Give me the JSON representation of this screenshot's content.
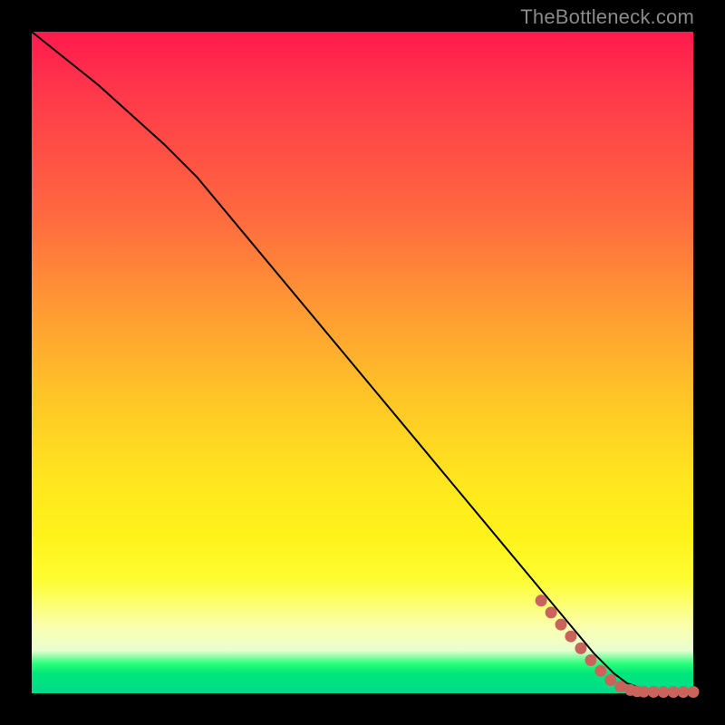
{
  "watermark": "TheBottleneck.com",
  "chart_data": {
    "type": "line",
    "title": "",
    "xlabel": "",
    "ylabel": "",
    "xlim": [
      0,
      100
    ],
    "ylim": [
      0,
      100
    ],
    "series": [
      {
        "name": "curve",
        "x": [
          0,
          10,
          20,
          25,
          30,
          40,
          50,
          60,
          70,
          80,
          85,
          88,
          90,
          92,
          95,
          98,
          100
        ],
        "y": [
          100,
          92,
          83,
          78,
          72,
          60,
          48,
          36,
          24,
          12,
          6,
          3,
          1.5,
          0.8,
          0.4,
          0.2,
          0.15
        ],
        "style": "solid",
        "color": "#000000"
      }
    ],
    "markers": {
      "color": "#c9635b",
      "points": [
        {
          "x": 77,
          "y": 14
        },
        {
          "x": 78.5,
          "y": 12.2
        },
        {
          "x": 80,
          "y": 10.4
        },
        {
          "x": 81.5,
          "y": 8.6
        },
        {
          "x": 83,
          "y": 6.8
        },
        {
          "x": 84.5,
          "y": 5.0
        },
        {
          "x": 86,
          "y": 3.4
        },
        {
          "x": 87.5,
          "y": 2.0
        },
        {
          "x": 89,
          "y": 1.0
        },
        {
          "x": 90.5,
          "y": 0.5
        },
        {
          "x": 91.5,
          "y": 0.3
        },
        {
          "x": 92.5,
          "y": 0.25
        },
        {
          "x": 94,
          "y": 0.22
        },
        {
          "x": 95.5,
          "y": 0.2
        },
        {
          "x": 97,
          "y": 0.2
        },
        {
          "x": 98.5,
          "y": 0.2
        },
        {
          "x": 100,
          "y": 0.2
        }
      ]
    },
    "background_gradient": {
      "direction": "vertical",
      "stops": [
        {
          "pos": 0.0,
          "color": "#ff1a4d"
        },
        {
          "pos": 0.5,
          "color": "#ffc726"
        },
        {
          "pos": 0.8,
          "color": "#fdfd33"
        },
        {
          "pos": 0.95,
          "color": "#2bff7c"
        },
        {
          "pos": 1.0,
          "color": "#00d98c"
        }
      ]
    }
  }
}
